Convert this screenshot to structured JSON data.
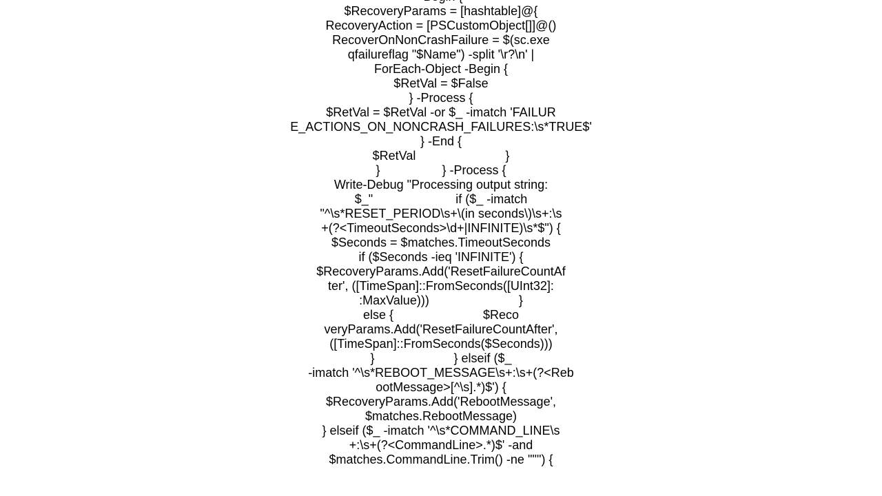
{
  "document": {
    "lines": [
      "-Begin {",
      "$RecoveryParams = [hashtable]@{",
      "RecoveryAction = [PSCustomObject[]]@()",
      "RecoverOnNonCrashFailure = $(sc.exe",
      "qfailureflag \"$Name\") -split '\\r?\\n' |",
      "ForEach-Object -Begin {",
      "$RetVal = $False",
      "} -Process {",
      "$RetVal = $RetVal -or $_ -imatch 'FAILUR",
      "E_ACTIONS_ON_NONCRASH_FAILURES:\\s*TRUE$'",
      "} -End {",
      "$RetVal                          }",
      "}                  } -Process {",
      "Write-Debug \"Processing output string:",
      "$_\"                        if ($_ -imatch",
      "\"^\\s*RESET_PERIOD\\s+\\(in seconds\\)\\s+:\\s",
      "+(?<TimeoutSeconds>\\d+|INFINITE)\\s*$\") {",
      "$Seconds = $matches.TimeoutSeconds",
      "if ($Seconds -ieq 'INFINITE') {",
      "$RecoveryParams.Add('ResetFailureCountAf",
      "ter', ([TimeSpan]::FromSeconds([UInt32]:",
      ":MaxValue)))                          }",
      "else {                          $Reco",
      "veryParams.Add('ResetFailureCountAfter',",
      "([TimeSpan]::FromSeconds($Seconds)))",
      "}                       } elseif ($_",
      "-imatch '^\\s*REBOOT_MESSAGE\\s+:\\s+(?<Reb",
      "ootMessage>[^\\s].*)$') {",
      "$RecoveryParams.Add('RebootMessage',",
      "$matches.RebootMessage)",
      "} elseif ($_ -imatch '^\\s*COMMAND_LINE\\s",
      "+:\\s+(?<CommandLine>.*)$' -and",
      "$matches.CommandLine.Trim() -ne '\"\"') {"
    ]
  }
}
